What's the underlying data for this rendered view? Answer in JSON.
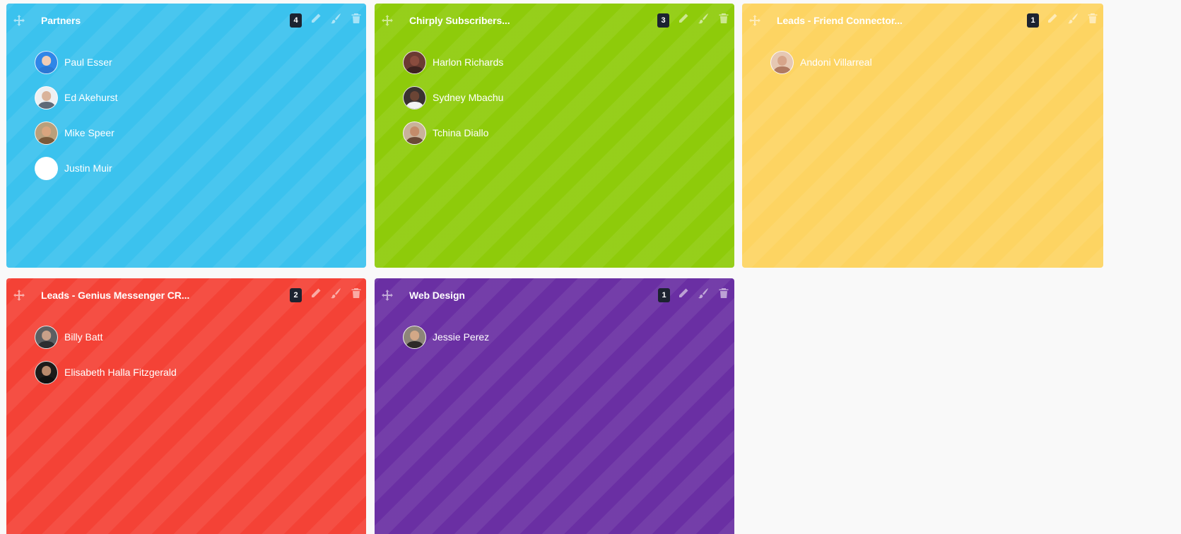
{
  "boards": [
    {
      "title": "Partners",
      "count": "4",
      "color": "#3bc2ee",
      "members": [
        {
          "name": "Paul Esser",
          "avatar_bg": "#2f86e8",
          "skin": "#f0cdb5",
          "shirt": "#2b78d4"
        },
        {
          "name": "Ed Akehurst",
          "avatar_bg": "#eef0f2",
          "skin": "#d9b39a",
          "shirt": "#5f6a78"
        },
        {
          "name": "Mike Speer",
          "avatar_bg": "#b9a07c",
          "skin": "#d9a57e",
          "shirt": "#7a5a3a"
        },
        {
          "name": "Justin Muir",
          "avatar_bg": "#ffffff",
          "skin": "#ffffff",
          "shirt": "#ffffff"
        }
      ]
    },
    {
      "title": "Chirply Subscribers...",
      "count": "3",
      "color": "#8ecb0a",
      "members": [
        {
          "name": "Harlon Richards",
          "avatar_bg": "#6b3b32",
          "skin": "#8a4c3e",
          "shirt": "#3e2320"
        },
        {
          "name": "Sydney Mbachu",
          "avatar_bg": "#3a3230",
          "skin": "#6b4535",
          "shirt": "#f3f3f3"
        },
        {
          "name": "Tchina Diallo",
          "avatar_bg": "#c9b29a",
          "skin": "#c48c6a",
          "shirt": "#6b4a36"
        }
      ]
    },
    {
      "title": "Leads - Friend Connector...",
      "count": "1",
      "color": "#fdd462",
      "members": [
        {
          "name": "Andoni Villarreal",
          "avatar_bg": "#e6c8b3",
          "skin": "#d7a58a",
          "shirt": "#b07a62"
        }
      ]
    },
    {
      "title": "Leads - Genius Messenger CR...",
      "count": "2",
      "color": "#f44236",
      "members": [
        {
          "name": "Billy Batt",
          "avatar_bg": "#5d5f62",
          "skin": "#c9a089",
          "shirt": "#2c2e31"
        },
        {
          "name": "Elisabeth Halla Fitzgerald",
          "avatar_bg": "#1e1b1a",
          "skin": "#b98a6d",
          "shirt": "#111111"
        }
      ]
    },
    {
      "title": "Web Design",
      "count": "1",
      "color": "#6a2fa3",
      "members": [
        {
          "name": "Jessie Perez",
          "avatar_bg": "#8d8579",
          "skin": "#d2a887",
          "shirt": "#2d2a28"
        }
      ]
    }
  ]
}
